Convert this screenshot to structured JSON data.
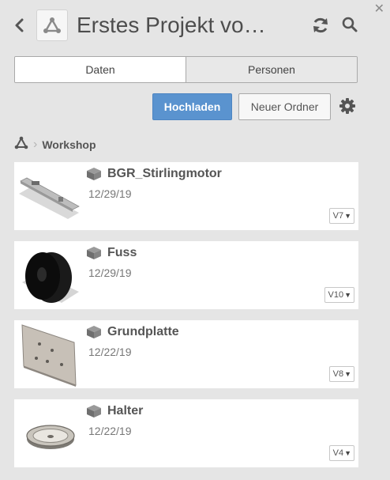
{
  "header": {
    "title": "Erstes Projekt vo…"
  },
  "tabs": [
    {
      "label": "Daten"
    },
    {
      "label": "Personen"
    }
  ],
  "actions": {
    "upload_label": "Hochladen",
    "new_folder_label": "Neuer Ordner"
  },
  "breadcrumb": {
    "current": "Workshop"
  },
  "items": [
    {
      "name": "BGR_Stirlingmotor",
      "date": "12/29/19",
      "version": "V7"
    },
    {
      "name": "Fuss",
      "date": "12/29/19",
      "version": "V10"
    },
    {
      "name": "Grundplatte",
      "date": "12/22/19",
      "version": "V8"
    },
    {
      "name": "Halter",
      "date": "12/22/19",
      "version": "V4"
    }
  ],
  "icons": {
    "close": "close-icon",
    "back": "chevron-left-icon",
    "project": "project-hub-icon",
    "refresh": "refresh-icon",
    "search": "search-icon",
    "settings": "gear-icon",
    "item_type": "component-cube-icon"
  },
  "colors": {
    "accent": "#5a93cf",
    "background": "#e5e5e5",
    "card": "#ffffff"
  }
}
